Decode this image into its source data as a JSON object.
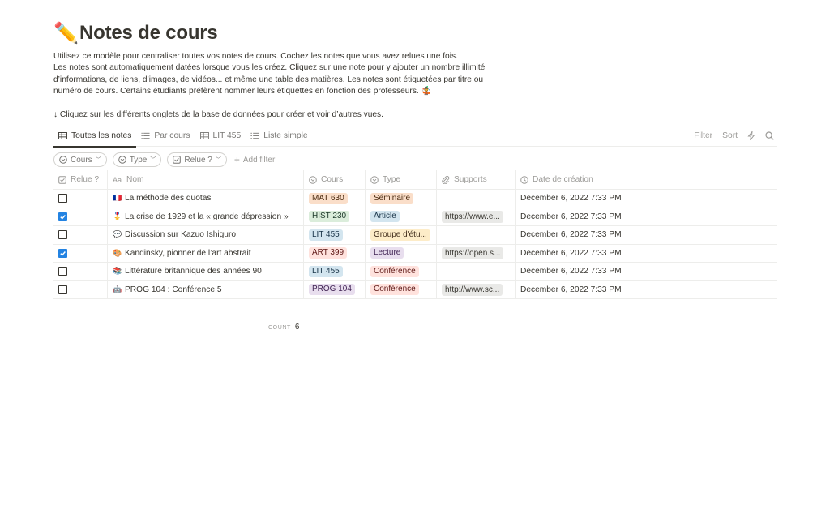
{
  "page": {
    "icon": "✏️",
    "title": "Notes de cours",
    "description": [
      "Utilisez ce modèle pour centraliser toutes vos notes de cours. Cochez les notes que vous avez relues une fois.",
      "Les notes sont automatiquement datées lorsque vous les créez. Cliquez sur une note pour y ajouter un nombre illimité d’informations, de liens, d’images, de vidéos... et même une table des matières. Les notes sont étiquetées par titre ou numéro de cours. Certains étudiants préfèrent nommer leurs étiquettes en fonction des professeurs. 🤹"
    ],
    "hint": "↓ Cliquez sur les différents onglets de la base de données pour créer et voir d’autres vues."
  },
  "tabs": [
    {
      "label": "Toutes les notes",
      "icon": "table-icon",
      "active": true
    },
    {
      "label": "Par cours",
      "icon": "list-icon",
      "active": false
    },
    {
      "label": "LIT 455",
      "icon": "table-icon",
      "active": false
    },
    {
      "label": "Liste simple",
      "icon": "list-icon",
      "active": false
    }
  ],
  "toolbar": {
    "filter_label": "Filter",
    "sort_label": "Sort",
    "automation_icon": "lightning-icon",
    "search_icon": "search-icon"
  },
  "filters": [
    {
      "label": "Cours",
      "icon": "select-icon"
    },
    {
      "label": "Type",
      "icon": "select-icon"
    },
    {
      "label": "Relue ?",
      "icon": "checkbox-icon"
    }
  ],
  "add_filter_label": "Add filter",
  "columns": [
    {
      "label": "Relue ?",
      "icon": "checkbox-icon"
    },
    {
      "label": "Nom",
      "icon": "title-icon"
    },
    {
      "label": "Cours",
      "icon": "select-icon"
    },
    {
      "label": "Type",
      "icon": "select-icon"
    },
    {
      "label": "Supports",
      "icon": "url-icon"
    },
    {
      "label": "Date de création",
      "icon": "clock-icon"
    }
  ],
  "rows": [
    {
      "checked": false,
      "emoji": "🇫🇷",
      "name": "La méthode des quotas",
      "cours": "MAT 630",
      "type": "Séminaire",
      "support": "",
      "date": "December 6, 2022 7:33 PM"
    },
    {
      "checked": true,
      "emoji": "🎖️",
      "name": "La crise de 1929 et la « grande dépression »",
      "cours": "HIST 230",
      "type": "Article",
      "support": "https://www.e...",
      "date": "December 6, 2022 7:33 PM"
    },
    {
      "checked": false,
      "emoji": "💬",
      "name": "Discussion sur Kazuo Ishiguro",
      "cours": "LIT 455",
      "type": "Groupe d'étu...",
      "support": "",
      "date": "December 6, 2022 7:33 PM"
    },
    {
      "checked": true,
      "emoji": "🎨",
      "name": "Kandinsky, pionner de l’art abstrait",
      "cours": "ART 399",
      "type": "Lecture",
      "support": "https://open.s...",
      "date": "December 6, 2022 7:33 PM"
    },
    {
      "checked": false,
      "emoji": "📚",
      "name": "Littérature britannique des années 90",
      "cours": "LIT 455",
      "type": "Conférence",
      "support": "",
      "date": "December 6, 2022 7:33 PM"
    },
    {
      "checked": false,
      "emoji": "🤖",
      "name": "PROG 104 : Conférence 5",
      "cours": "PROG 104",
      "type": "Conférence",
      "support": "http://www.sc...",
      "date": "December 6, 2022 7:33 PM"
    }
  ],
  "tag_colors": {
    "MAT 630": {
      "bg": "#fadec9",
      "fg": "#49290e"
    },
    "HIST 230": {
      "bg": "#dbeddb",
      "fg": "#1c3829"
    },
    "LIT 455": {
      "bg": "#d3e5ef",
      "fg": "#183347"
    },
    "ART 399": {
      "bg": "#ffe2dd",
      "fg": "#5d1715"
    },
    "PROG 104": {
      "bg": "#e8deee",
      "fg": "#412454"
    },
    "Séminaire": {
      "bg": "#fadec9",
      "fg": "#49290e"
    },
    "Article": {
      "bg": "#d3e5ef",
      "fg": "#183347"
    },
    "Groupe d'étu...": {
      "bg": "#fdecc8",
      "fg": "#402c1b"
    },
    "Lecture": {
      "bg": "#e8deee",
      "fg": "#412454"
    },
    "Conférence": {
      "bg": "#ffe2dd",
      "fg": "#5d1715"
    }
  },
  "footer": {
    "count_label": "COUNT",
    "count_value": "6"
  }
}
